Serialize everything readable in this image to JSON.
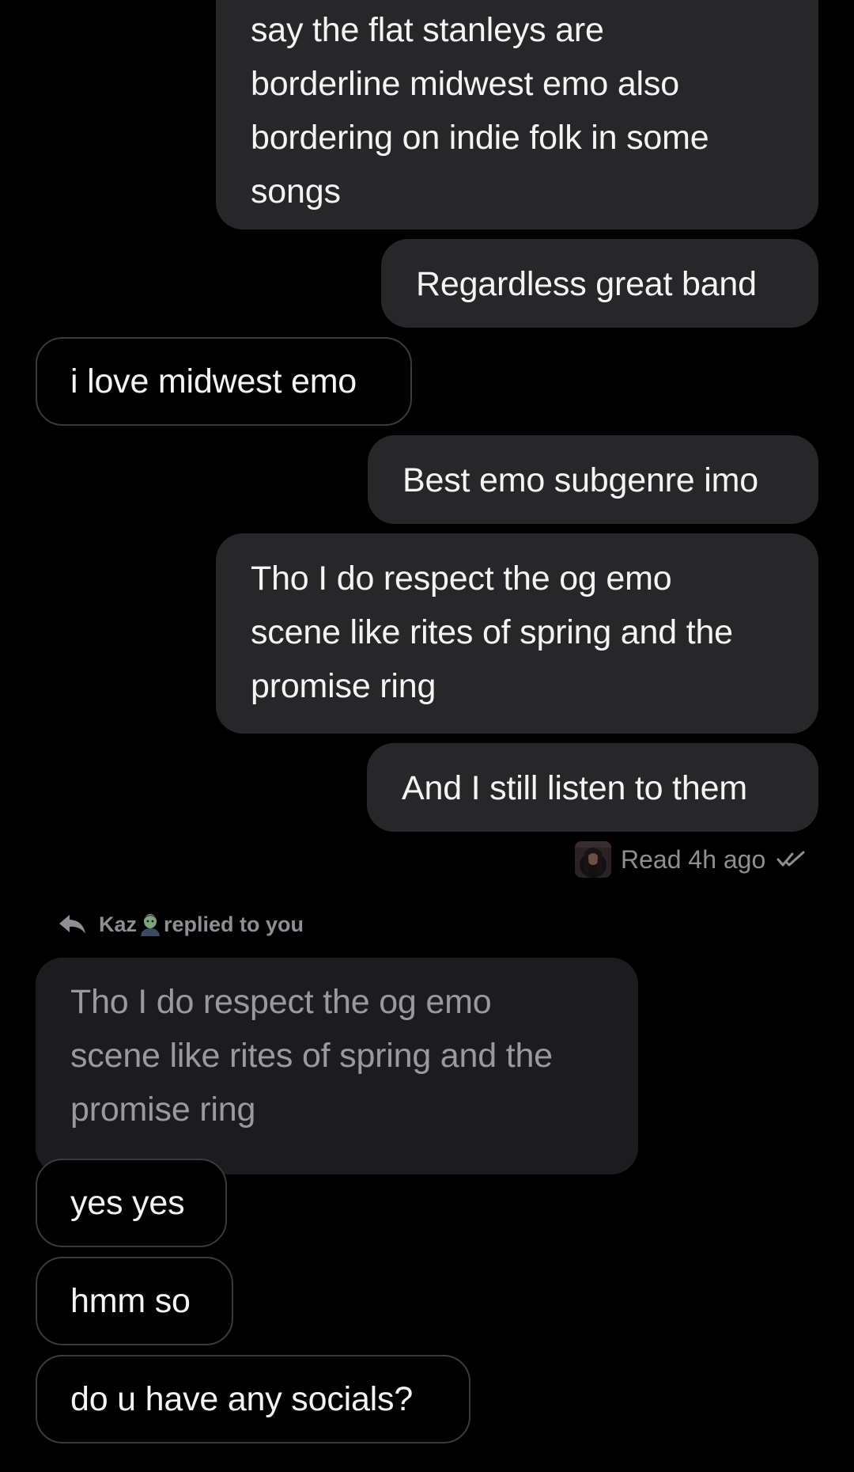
{
  "messages": {
    "m1": {
      "lines": [
        "say the flat stanleys are",
        "borderline midwest emo also",
        "bordering on indie folk in some",
        "songs"
      ]
    },
    "m2": {
      "text": "Regardless great band"
    },
    "m3": {
      "text": "i love midwest emo"
    },
    "m4": {
      "text": "Best emo subgenre imo"
    },
    "m5": {
      "lines": [
        "Tho I do respect the og emo",
        "scene like rites of spring and the",
        "promise ring"
      ]
    },
    "m6": {
      "text": "And I still listen to them"
    }
  },
  "receipt": {
    "text": "Read 4h ago",
    "icon": "double-check-icon"
  },
  "reply": {
    "name": "Kaz",
    "suffix": "replied to you",
    "icon": "reply-arrow-icon",
    "emoji": "zombie-emoji",
    "quoted_lines": [
      "Tho I do respect the og emo",
      "scene like rites of spring and the",
      "promise ring"
    ]
  },
  "incoming": {
    "m7": {
      "text": "yes yes"
    },
    "m8": {
      "text": "hmm so"
    },
    "m9": {
      "text": "do u have any socials?"
    }
  },
  "colors": {
    "background": "#000000",
    "outgoing_bubble": "#27272a",
    "incoming_border": "#3a3a3d",
    "quoted_bubble": "#1c1c1e",
    "muted_text": "#8e8e93"
  }
}
